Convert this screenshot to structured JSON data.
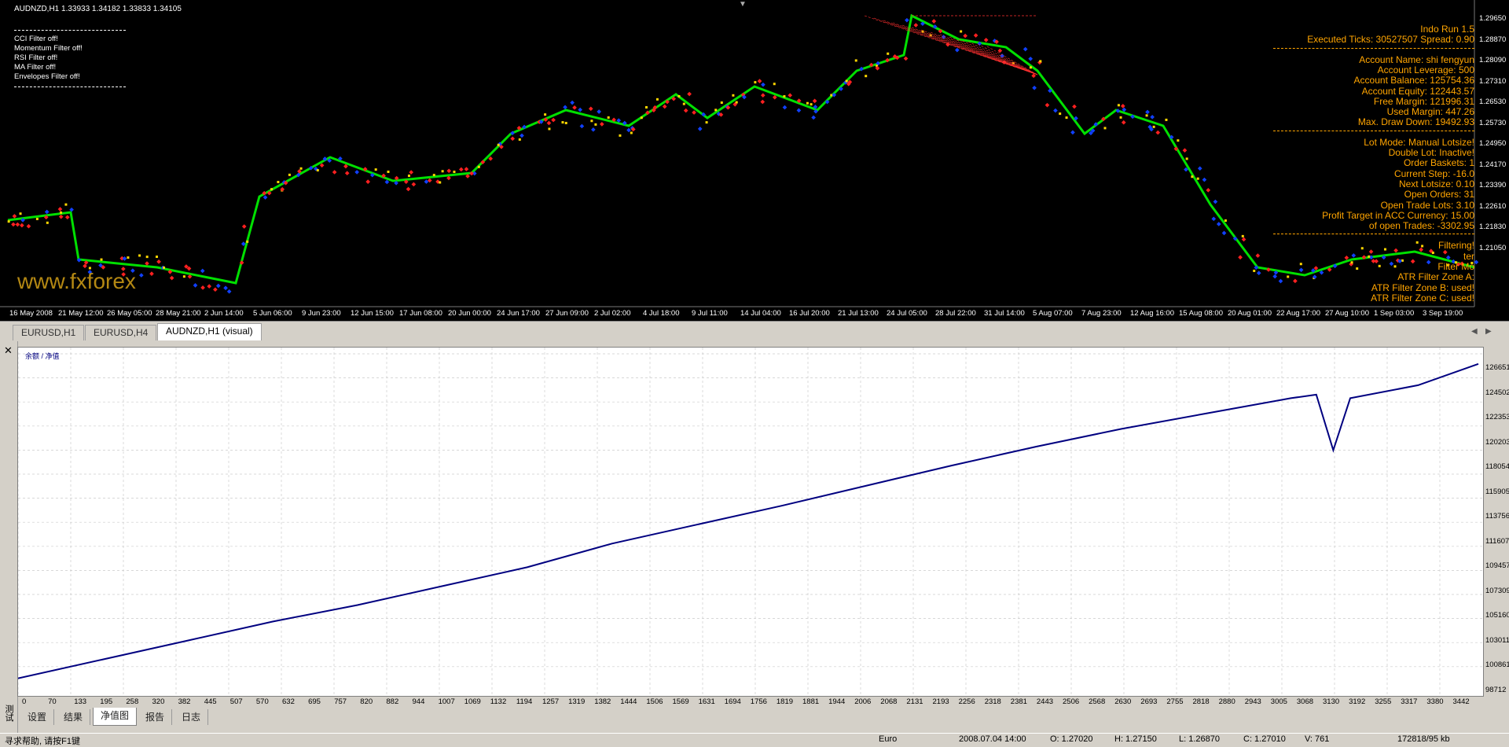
{
  "price_chart": {
    "header": "AUDNZD,H1  1.33933 1.34182 1.33833 1.34105",
    "filters": [
      "CCI Filter off!",
      "Momentum Filter off!",
      "RSI Filter off!",
      "MA Filter off!",
      "Envelopes Filter off!"
    ],
    "overlay_top": [
      "Indo Run 1.5",
      "Executed Ticks: 30527507  Spread: 0.90"
    ],
    "account_info": [
      "Account Name: shi fengyun",
      "Account Leverage: 500",
      "Account Balance: 125754.36",
      "Account Equity: 122443.57",
      "Free Margin: 121996.31",
      "Used Margin: 447.26",
      "Max. Draw Down: 19492.93"
    ],
    "lot_info": [
      "Lot Mode: Manual Lotsize!",
      "Double Lot: Inactive!",
      "Order Baskets: 1",
      "Current Step: -16.0",
      "Next Lotsize: 0.10",
      "Open Orders: 31",
      "Open Trade Lots: 3.10",
      "Profit Target in ACC Currency: 15.00",
      "of open Trades: -3302.95"
    ],
    "filter_info": [
      "Filtering!",
      "ter",
      "Filter Mo",
      "ATR Filter Zone A:",
      "ATR Filter Zone B: used!",
      "ATR Filter Zone C: used!"
    ],
    "watermark": "www.fxforex",
    "y_ticks": [
      "1.29650",
      "1.28870",
      "1.28090",
      "1.27310",
      "1.26530",
      "1.25730",
      "1.24950",
      "1.24170",
      "1.23390",
      "1.22610",
      "1.21830",
      "1.21050"
    ],
    "x_ticks": [
      "16 May 2008",
      "21 May 12:00",
      "26 May 05:00",
      "28 May 21:00",
      "2 Jun 14:00",
      "5 Jun 06:00",
      "9 Jun 23:00",
      "12 Jun 15:00",
      "17 Jun 08:00",
      "20 Jun 00:00",
      "24 Jun 17:00",
      "27 Jun 09:00",
      "2 Jul 02:00",
      "4 Jul 18:00",
      "9 Jul 11:00",
      "14 Jul 04:00",
      "16 Jul 20:00",
      "21 Jul 13:00",
      "24 Jul 05:00",
      "28 Jul 22:00",
      "31 Jul 14:00",
      "5 Aug 07:00",
      "7 Aug 23:00",
      "12 Aug 16:00",
      "15 Aug 08:00",
      "20 Aug 01:00",
      "22 Aug 17:00",
      "27 Aug 10:00",
      "1 Sep 03:00",
      "3 Sep 19:00"
    ]
  },
  "chart_tabs": [
    "EURUSD,H1",
    "EURUSD,H4",
    "AUDNZD,H1 (visual)"
  ],
  "equity_chart": {
    "legend": "余额 / 净值",
    "y_ticks": [
      "126651",
      "124502",
      "122353",
      "120203",
      "118054",
      "115905",
      "113756",
      "111607",
      "109457",
      "107309",
      "105160",
      "103011",
      "100861",
      "98712"
    ],
    "x_ticks": [
      "0",
      "70",
      "133",
      "195",
      "258",
      "320",
      "382",
      "445",
      "507",
      "570",
      "632",
      "695",
      "757",
      "820",
      "882",
      "944",
      "1007",
      "1069",
      "1132",
      "1194",
      "1257",
      "1319",
      "1382",
      "1444",
      "1506",
      "1569",
      "1631",
      "1694",
      "1756",
      "1819",
      "1881",
      "1944",
      "2006",
      "2068",
      "2131",
      "2193",
      "2256",
      "2318",
      "2381",
      "2443",
      "2506",
      "2568",
      "2630",
      "2693",
      "2755",
      "2818",
      "2880",
      "2943",
      "3005",
      "3068",
      "3130",
      "3192",
      "3255",
      "3317",
      "3380",
      "3442"
    ]
  },
  "chart_data": {
    "type": "line",
    "x": [
      0,
      200,
      400,
      600,
      800,
      1000,
      1200,
      1400,
      1600,
      1800,
      2000,
      2200,
      2400,
      2600,
      2800,
      3000,
      3060,
      3100,
      3140,
      3300,
      3442
    ],
    "series": [
      {
        "values": [
          99200,
          100800,
          102400,
          104000,
          105400,
          107000,
          108600,
          110600,
          112200,
          113800,
          115500,
          117200,
          118800,
          120300,
          121600,
          122900,
          123200,
          118500,
          122900,
          124000,
          125800
        ]
      }
    ],
    "ylim": [
      98712,
      126651
    ]
  },
  "bottom_tabs": [
    "设置",
    "结果",
    "净值图",
    "报告",
    "日志"
  ],
  "left_label": "测试",
  "status": {
    "help": "寻求帮助, 请按F1键",
    "profile": "Euro",
    "time": "2008.07.04 14:00",
    "open": "O: 1.27020",
    "high": "H: 1.27150",
    "low": "L: 1.26870",
    "close": "C: 1.27010",
    "volume": "V: 761",
    "traffic": "172818/95 kb"
  },
  "colors": {
    "up_candle": "#00e000",
    "buy": "#1040ff",
    "sell": "#ff2020",
    "equity_line": "#000080",
    "orange": "#ffa500"
  }
}
